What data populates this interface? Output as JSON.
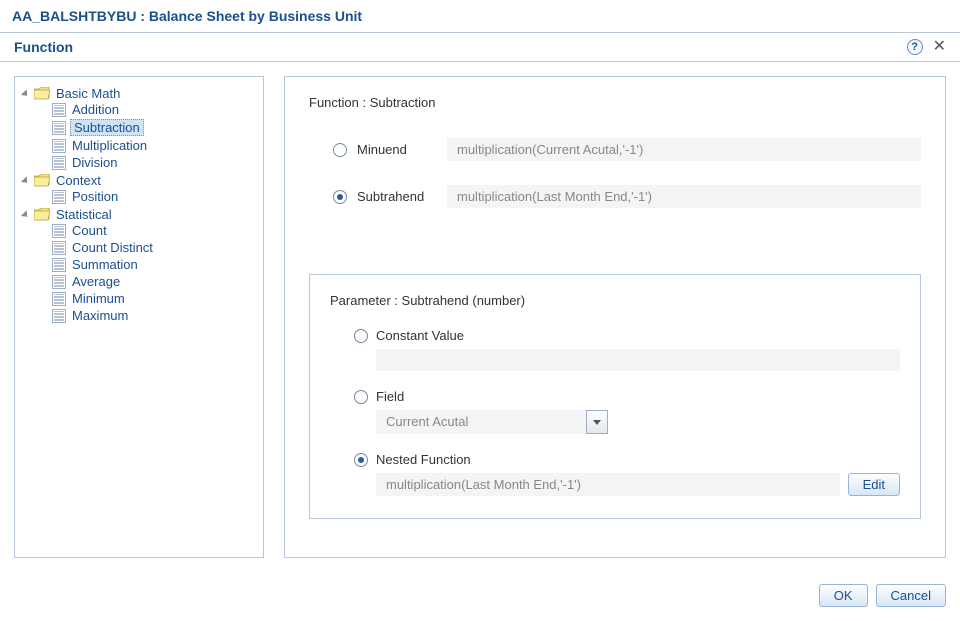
{
  "window": {
    "title": "AA_BALSHTBYBU : Balance Sheet by Business Unit"
  },
  "panel": {
    "title": "Function"
  },
  "tree": {
    "groups": [
      {
        "label": "Basic Math",
        "items": [
          {
            "label": "Addition"
          },
          {
            "label": "Subtraction",
            "selected": true
          },
          {
            "label": "Multiplication"
          },
          {
            "label": "Division"
          }
        ]
      },
      {
        "label": "Context",
        "items": [
          {
            "label": "Position"
          }
        ]
      },
      {
        "label": "Statistical",
        "items": [
          {
            "label": "Count"
          },
          {
            "label": "Count Distinct"
          },
          {
            "label": "Summation"
          },
          {
            "label": "Average"
          },
          {
            "label": "Minimum"
          },
          {
            "label": "Maximum"
          }
        ]
      }
    ]
  },
  "func": {
    "title": "Function : Subtraction",
    "args": {
      "minuend": {
        "label": "Minuend",
        "value": "multiplication(Current Acutal,'-1')"
      },
      "subtrahend": {
        "label": "Subtrahend",
        "value": "multiplication(Last Month End,'-1')"
      }
    }
  },
  "param": {
    "title": "Parameter : Subtrahend (number)",
    "constant": {
      "label": "Constant Value",
      "value": ""
    },
    "field": {
      "label": "Field",
      "value": "Current Acutal"
    },
    "nested": {
      "label": "Nested Function",
      "value": "multiplication(Last Month End,'-1')",
      "edit": "Edit"
    }
  },
  "buttons": {
    "ok": "OK",
    "cancel": "Cancel"
  }
}
